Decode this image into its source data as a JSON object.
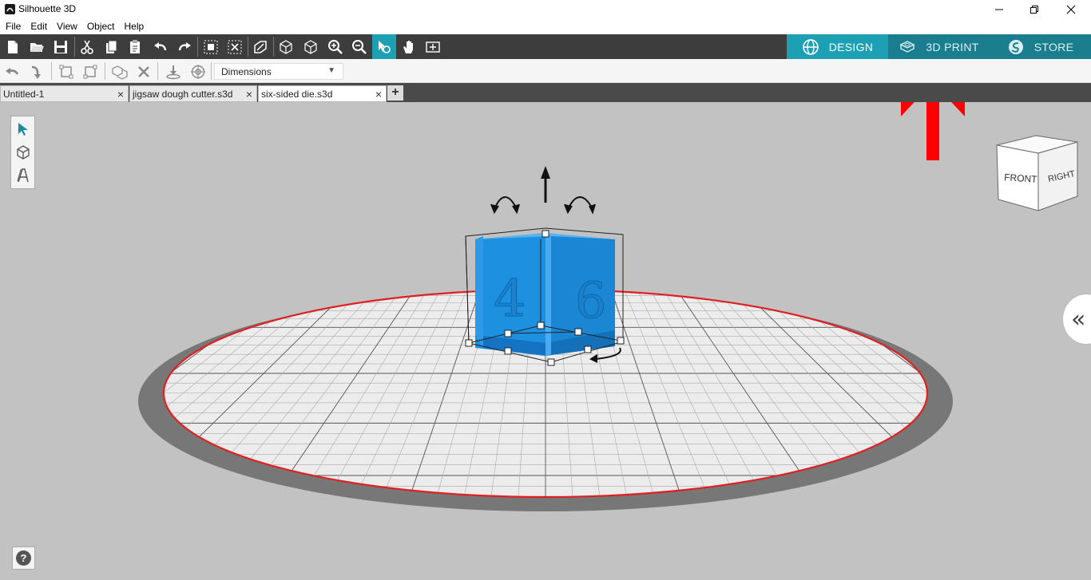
{
  "window": {
    "title": "Silhouette 3D"
  },
  "menu": [
    "File",
    "Edit",
    "View",
    "Object",
    "Help"
  ],
  "mode_tabs": {
    "design": "DESIGN",
    "print": "3D PRINT",
    "store": "STORE"
  },
  "secondary_toolbar": {
    "dimensions_select": "Dimensions"
  },
  "doc_tabs": [
    {
      "label": "Untitled-1"
    },
    {
      "label": "jigsaw dough cutter.s3d"
    },
    {
      "label": "six-sided die.s3d"
    }
  ],
  "view_cube": {
    "front": "FRONT",
    "right": "RIGHT"
  },
  "die_faces": {
    "front": "4",
    "right": "6"
  },
  "help_label": "?",
  "colors": {
    "accent": "#1ea0b4",
    "toolbar_dark": "#3d3d3d",
    "object_blue": "#1e90e0",
    "plate_edge": "#e02020",
    "annotation_arrow": "#ff0000"
  }
}
